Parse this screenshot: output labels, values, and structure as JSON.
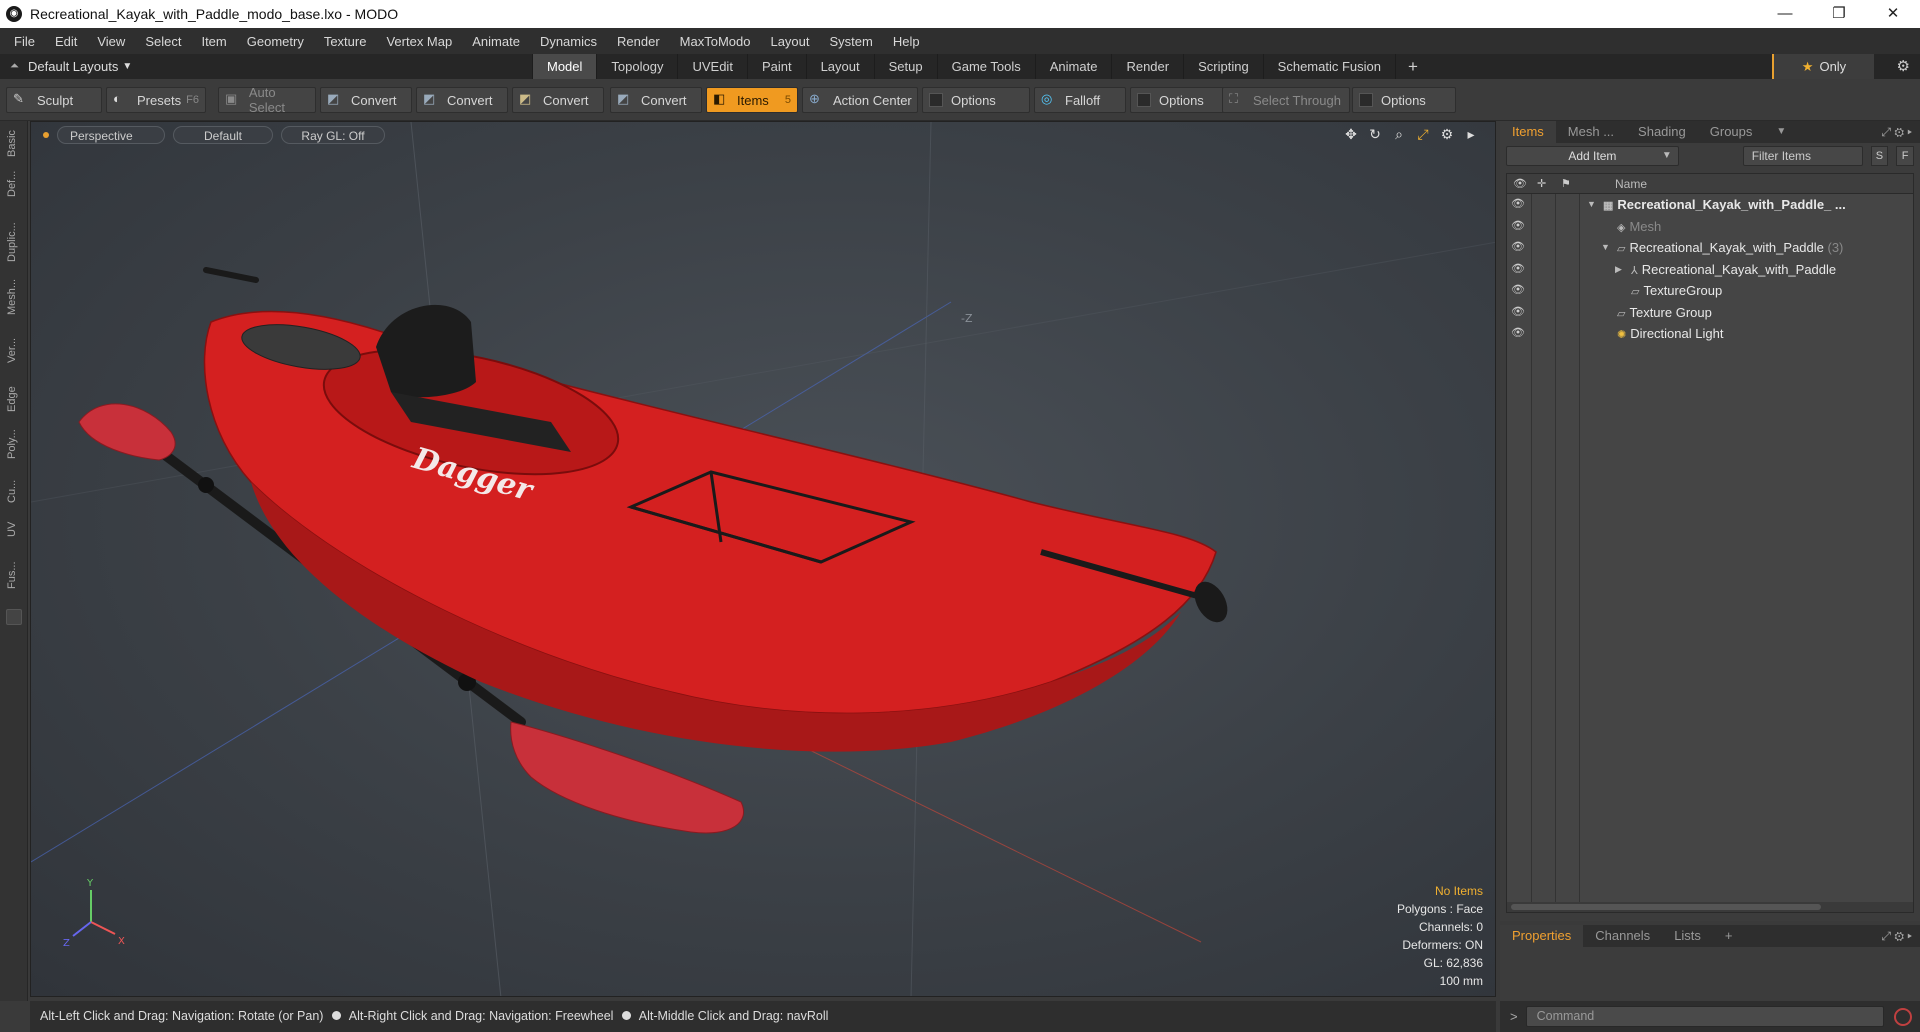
{
  "window": {
    "title": "Recreational_Kayak_with_Paddle_modo_base.lxo - MODO",
    "minimize": "—",
    "restore": "❐",
    "close": "✕"
  },
  "menu": [
    "File",
    "Edit",
    "View",
    "Select",
    "Item",
    "Geometry",
    "Texture",
    "Vertex Map",
    "Animate",
    "Dynamics",
    "Render",
    "MaxToModo",
    "Layout",
    "System",
    "Help"
  ],
  "layout_dropdown": "Default Layouts",
  "tabs": [
    "Model",
    "Topology",
    "UVEdit",
    "Paint",
    "Layout",
    "Setup",
    "Game Tools",
    "Animate",
    "Render",
    "Scripting",
    "Schematic Fusion"
  ],
  "active_tab": "Model",
  "only_label": "Only",
  "toolbar": {
    "sculpt": "Sculpt",
    "presets": "Presets",
    "presets_key": "F6",
    "auto_select": "Auto Select",
    "convert1": "Convert",
    "convert2": "Convert",
    "convert3": "Convert",
    "convert4": "Convert",
    "items": "Items",
    "items_key": "5",
    "action_center": "Action Center",
    "options1": "Options",
    "falloff": "Falloff",
    "options2": "Options",
    "select_through": "Select Through",
    "options3": "Options"
  },
  "left_strip": [
    "Basic",
    "Def...",
    "Duplic...",
    "Mesh...",
    "Ver...",
    "Edge",
    "Poly...",
    "Cu...",
    "UV",
    "Fus..."
  ],
  "viewport": {
    "view": "Perspective",
    "shading": "Default",
    "raygl": "Ray GL: Off",
    "brand_text": "Dagger",
    "axis_x": "X",
    "axis_y": "Y",
    "axis_z": "Z",
    "z_label": "-Z",
    "stats": {
      "items": "No Items",
      "polygons": "Polygons : Face",
      "channels": "Channels: 0",
      "deformers": "Deformers: ON",
      "gl": "GL: 62,836",
      "unit": "100 mm"
    }
  },
  "items_panel": {
    "tabs": [
      "Items",
      "Mesh ...",
      "Shading",
      "Groups"
    ],
    "active_tab": "Items",
    "add_item": "Add Item",
    "filter": "Filter Items",
    "s_btn": "S",
    "f_btn": "F",
    "name_col": "Name",
    "rows": [
      {
        "label": "Recreational_Kayak_with_Paddle_ ...",
        "depth": 0,
        "bold": true,
        "toggle": "▼",
        "icon": "scene-icon"
      },
      {
        "label": "Mesh",
        "depth": 1,
        "dim": true,
        "icon": "mesh-icon"
      },
      {
        "label": "Recreational_Kayak_with_Paddle",
        "count": "(3)",
        "depth": 1,
        "toggle": "▼",
        "icon": "group-icon"
      },
      {
        "label": "Recreational_Kayak_with_Paddle",
        "depth": 2,
        "toggle": "▶",
        "icon": "locator-icon"
      },
      {
        "label": "TextureGroup",
        "depth": 2,
        "icon": "group-icon"
      },
      {
        "label": "Texture Group",
        "depth": 1,
        "icon": "group-icon"
      },
      {
        "label": "Directional Light",
        "depth": 1,
        "icon": "light-icon"
      }
    ]
  },
  "properties_panel": {
    "tabs": [
      "Properties",
      "Channels",
      "Lists"
    ],
    "active_tab": "Properties"
  },
  "status": {
    "hint1": "Alt-Left Click and Drag: Navigation: Rotate (or Pan)",
    "hint2": "Alt-Right Click and Drag: Navigation: Freewheel",
    "hint3": "Alt-Middle Click and Drag: navRoll"
  },
  "command": {
    "prompt": ">",
    "placeholder": "Command"
  },
  "colors": {
    "accent": "#f09a20",
    "kayak": "#d42020",
    "paddle_blade": "#c8303a"
  }
}
